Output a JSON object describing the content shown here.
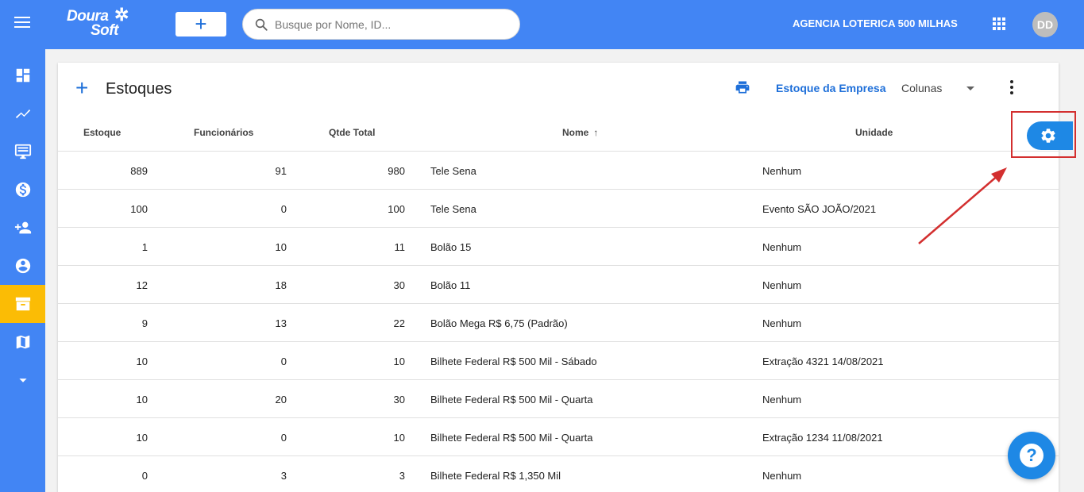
{
  "header": {
    "logo_line1": "Doura",
    "logo_line2": "Soft",
    "add_label": "+",
    "search_placeholder": "Busque por Nome, ID...",
    "company_name": "AGENCIA LOTERICA 500 MILHAS",
    "avatar_initials": "DD"
  },
  "sidebar": {
    "items": [
      {
        "icon": "dashboard-icon"
      },
      {
        "icon": "trending-icon"
      },
      {
        "icon": "monitor-icon"
      },
      {
        "icon": "dollar-icon"
      },
      {
        "icon": "add-person-icon"
      },
      {
        "icon": "account-icon"
      },
      {
        "icon": "archive-icon",
        "active": true
      },
      {
        "icon": "map-icon"
      },
      {
        "icon": "caret-down-icon"
      }
    ],
    "active_color": "#fbbc05",
    "bg_color": "#4285f4"
  },
  "card": {
    "add_label": "+",
    "title": "Estoques",
    "estoque_empresa": "Estoque da Empresa",
    "colunas": "Colunas"
  },
  "table": {
    "headers": {
      "estoque": "Estoque",
      "funcionarios": "Funcionários",
      "qtde_total": "Qtde Total",
      "nome": "Nome",
      "unidade": "Unidade"
    },
    "sort_arrow": "↑",
    "rows": [
      {
        "estoque": "889",
        "funcionarios": "91",
        "qtde_total": "980",
        "nome": "Tele Sena",
        "unidade": "Nenhum"
      },
      {
        "estoque": "100",
        "funcionarios": "0",
        "qtde_total": "100",
        "nome": "Tele Sena",
        "unidade": "Evento SÃO JOÃO/2021"
      },
      {
        "estoque": "1",
        "funcionarios": "10",
        "qtde_total": "11",
        "nome": "Bolão 15",
        "unidade": "Nenhum"
      },
      {
        "estoque": "12",
        "funcionarios": "18",
        "qtde_total": "30",
        "nome": "Bolão 11",
        "unidade": "Nenhum"
      },
      {
        "estoque": "9",
        "funcionarios": "13",
        "qtde_total": "22",
        "nome": "Bolão Mega R$ 6,75 (Padrão)",
        "unidade": "Nenhum"
      },
      {
        "estoque": "10",
        "funcionarios": "0",
        "qtde_total": "10",
        "nome": "Bilhete Federal R$ 500 Mil - Sábado",
        "unidade": "Extração 4321 14/08/2021"
      },
      {
        "estoque": "10",
        "funcionarios": "20",
        "qtde_total": "30",
        "nome": "Bilhete Federal R$ 500 Mil - Quarta",
        "unidade": "Nenhum"
      },
      {
        "estoque": "10",
        "funcionarios": "0",
        "qtde_total": "10",
        "nome": "Bilhete Federal R$ 500 Mil - Quarta",
        "unidade": "Extração 1234 11/08/2021"
      },
      {
        "estoque": "0",
        "funcionarios": "3",
        "qtde_total": "3",
        "nome": "Bilhete Federal R$ 1,350 Mil",
        "unidade": "Nenhum"
      }
    ]
  },
  "floating": {
    "settings_icon": "gear-icon",
    "help_label": "?",
    "highlight_color": "#d32f2f"
  }
}
